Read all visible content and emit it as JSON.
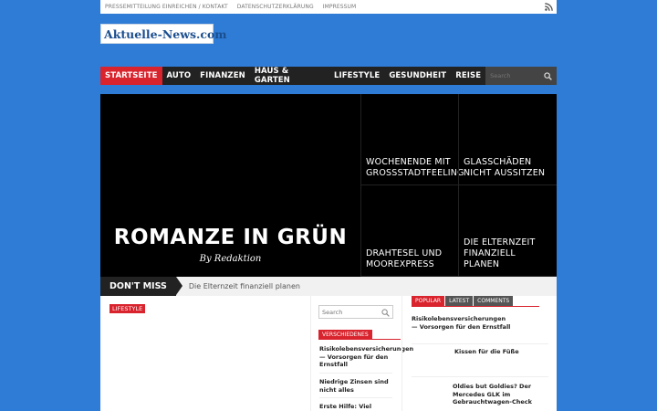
{
  "topbar": {
    "links": [
      "Pressemitteilung einreichen / Kontakt",
      "Datenschutzerklärung",
      "Impressum"
    ]
  },
  "logo": {
    "part1": "Aktuelle-",
    "part2": "News.com"
  },
  "nav": {
    "items": [
      "STARTSEITE",
      "AUTO",
      "FINANZEN",
      "HAUS & GARTEN",
      "LIFESTYLE",
      "GESUNDHEIT",
      "REISE"
    ],
    "active_index": 0,
    "search_placeholder": "Search"
  },
  "featured": {
    "hero_title": "ROMANZE IN GRÜN",
    "hero_byline": "By Redaktion",
    "tiles": [
      "WOCHENENDE MIT GROSSSTADTFEELING",
      "GLASSCHÄDEN NICHT AUSSITZEN",
      "DRAHTESEL UND MOOREXPRESS",
      "DIE ELTERNZEIT FINANZIELL PLANEN"
    ]
  },
  "dont_miss": {
    "label": "DON'T MISS",
    "text": "Die Elternzeit finanziell planen"
  },
  "main": {
    "category_badge": "LIFESTYLE"
  },
  "middle": {
    "search_placeholder": "Search",
    "section_tag": "VERSCHIEDENES",
    "articles": [
      "Risikolebensversicherungen — Vorsorgen für den Ernstfall",
      "Niedrige Zinsen sind nicht alles",
      "Erste Hilfe: Viel"
    ]
  },
  "right": {
    "tabs": [
      "POPULAR",
      "LATEST",
      "COMMENTS"
    ],
    "active_tab": 0,
    "articles": [
      "Risikolebensversicherungen — Vorsorgen für den Ernstfall",
      "Kissen für die Füße",
      "Oldies but Goldies? Der Mercedes GLK im Gebrauchtwagen-Check"
    ]
  },
  "colors": {
    "background": "#2f7cd6",
    "accent": "#d9232d",
    "nav": "#222222"
  }
}
